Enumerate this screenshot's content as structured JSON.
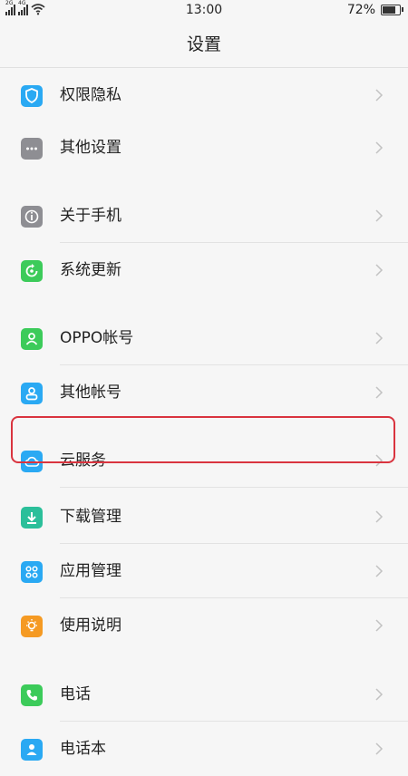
{
  "status": {
    "time": "13:00",
    "battery": "72%",
    "battery_level": 0.72,
    "signal1": "2G",
    "signal2": "4G"
  },
  "header": {
    "title": "设置"
  },
  "items": [
    {
      "label": "权限隐私",
      "icon": "shield-icon",
      "color": "#2aa9f3"
    },
    {
      "label": "其他设置",
      "icon": "more-icon",
      "color": "#8e8e93"
    },
    {
      "label": "关于手机",
      "icon": "info-icon",
      "color": "#8e8e93"
    },
    {
      "label": "系统更新",
      "icon": "update-icon",
      "color": "#3ccb5a"
    },
    {
      "label": "OPPO帐号",
      "icon": "person-icon",
      "color": "#3ccb5a"
    },
    {
      "label": "其他帐号",
      "icon": "account-icon",
      "color": "#2aa9f3"
    },
    {
      "label": "云服务",
      "icon": "cloud-icon",
      "color": "#2aa9f3"
    },
    {
      "label": "下载管理",
      "icon": "download-icon",
      "color": "#2bbf9a"
    },
    {
      "label": "应用管理",
      "icon": "apps-icon",
      "color": "#2aa9f3"
    },
    {
      "label": "使用说明",
      "icon": "lightbulb-icon",
      "color": "#f59a23"
    },
    {
      "label": "电话",
      "icon": "phone-icon",
      "color": "#3ccb5a"
    },
    {
      "label": "电话本",
      "icon": "contacts-icon",
      "color": "#2aa9f3"
    }
  ],
  "highlight_color": "#d9343f"
}
